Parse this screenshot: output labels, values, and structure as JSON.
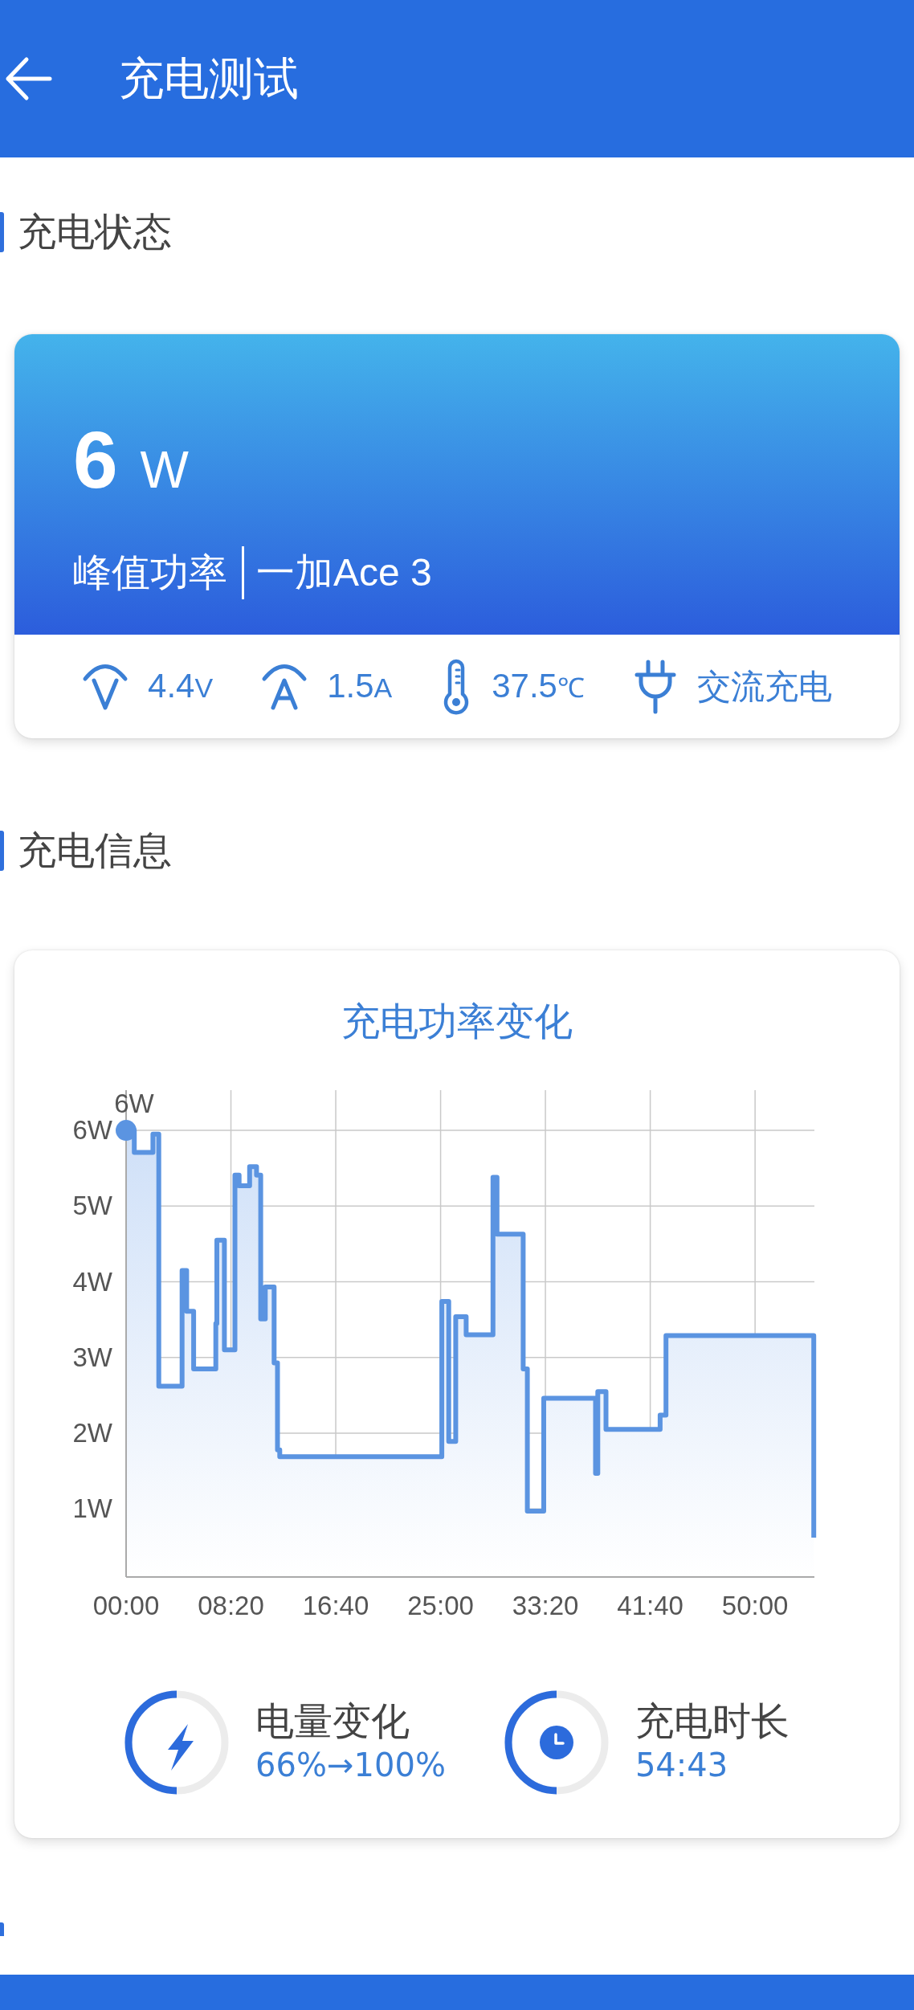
{
  "header": {
    "title": "充电测试"
  },
  "status_section": {
    "title": "充电状态",
    "peak_power": {
      "value": "6",
      "unit": "W",
      "label": "峰值功率",
      "device": "一加Ace 3"
    },
    "readings": [
      {
        "kind": "voltage",
        "value": "4.4",
        "unit": "V"
      },
      {
        "kind": "current",
        "value": "1.5",
        "unit": "A"
      },
      {
        "kind": "temperature",
        "value": "37.5",
        "unit": "℃"
      },
      {
        "kind": "source",
        "value": "交流充电"
      }
    ]
  },
  "info_section": {
    "title": "充电信息",
    "chart_data": {
      "type": "area",
      "title": "充电功率变化",
      "grid": true,
      "x": [
        0,
        39,
        39,
        128,
        128,
        156,
        156,
        267,
        267,
        289,
        289,
        322,
        322,
        428,
        428,
        433,
        433,
        469,
        469,
        519,
        519,
        539,
        539,
        589,
        589,
        622,
        622,
        642,
        642,
        664,
        664,
        706,
        706,
        722,
        722,
        733,
        733,
        1506,
        1506,
        1539,
        1539,
        1572,
        1572,
        1622,
        1622,
        1750,
        1750,
        1769,
        1769,
        1894,
        1894,
        1914,
        1914,
        1992,
        1992,
        2239,
        2239,
        2250,
        2250,
        2289,
        2289,
        2547,
        2547,
        2575,
        2575,
        3280,
        3280
      ],
      "values": [
        6.0,
        6.0,
        5.71,
        5.71,
        5.95,
        5.95,
        2.62,
        2.62,
        4.15,
        4.15,
        3.61,
        3.61,
        2.85,
        2.85,
        3.45,
        3.45,
        4.55,
        4.55,
        3.1,
        3.1,
        5.41,
        5.41,
        5.27,
        5.27,
        5.52,
        5.52,
        5.41,
        5.41,
        3.51,
        3.51,
        3.93,
        3.93,
        2.93,
        2.93,
        1.78,
        1.78,
        1.69,
        1.69,
        3.74,
        3.74,
        1.89,
        1.89,
        3.54,
        3.54,
        3.3,
        3.3,
        5.38,
        5.38,
        4.63,
        4.63,
        2.85,
        2.85,
        0.97,
        0.97,
        2.46,
        2.46,
        1.47,
        1.47,
        2.55,
        2.55,
        2.05,
        2.05,
        2.24,
        2.24,
        3.29,
        3.29,
        0.62
      ],
      "xlim": [
        0,
        3283
      ],
      "ylim": [
        0.1,
        6.5
      ],
      "xticks": [
        {
          "value": 0,
          "label": "00:00"
        },
        {
          "value": 500,
          "label": "08:20"
        },
        {
          "value": 1000,
          "label": "16:40"
        },
        {
          "value": 1500,
          "label": "25:00"
        },
        {
          "value": 2000,
          "label": "33:20"
        },
        {
          "value": 2500,
          "label": "41:40"
        },
        {
          "value": 3000,
          "label": "50:00"
        }
      ],
      "yticks": [
        {
          "value": 1,
          "label": "1W"
        },
        {
          "value": 2,
          "label": "2W"
        },
        {
          "value": 3,
          "label": "3W"
        },
        {
          "value": 4,
          "label": "4W"
        },
        {
          "value": 5,
          "label": "5W"
        },
        {
          "value": 6,
          "label": "6W"
        }
      ],
      "annotations": [
        {
          "x": 0,
          "y": 6,
          "text": "6W"
        }
      ]
    },
    "stats": [
      {
        "kind": "battery",
        "label": "电量变化",
        "value": "66%→100%"
      },
      {
        "kind": "duration",
        "label": "充电时长",
        "value": "54:43"
      }
    ]
  }
}
